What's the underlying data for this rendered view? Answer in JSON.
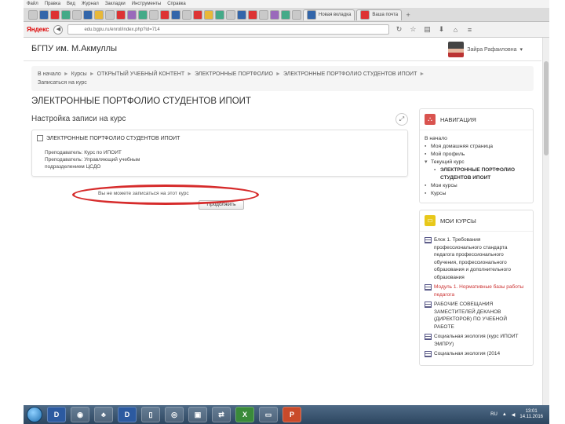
{
  "browser": {
    "menu": [
      "Файл",
      "Правка",
      "Вид",
      "Журнал",
      "Закладки",
      "Инструменты",
      "Справка"
    ],
    "tab_titles": [
      "Новая вкладка",
      "Ваша почта"
    ],
    "search_logo": "Яндекс",
    "url": "edu.bgpu.ru/enrol/index.php?id=714"
  },
  "site": {
    "name": "БГПУ им. М.Акмуллы",
    "user_name": "Зайра Рафаиловна"
  },
  "breadcrumb": {
    "items": [
      "В начало",
      "Курсы",
      "ОТКРЫТЫЙ УЧЕБНЫЙ КОНТЕНТ",
      "ЭЛЕКТРОННЫЕ ПОРТФОЛИО",
      "ЭЛЕКТРОННЫЕ ПОРТФОЛИО СТУДЕНТОВ ИПОИТ",
      "Записаться на курс"
    ]
  },
  "page_title": "ЭЛЕКТРОННЫЕ ПОРТФОЛИО СТУДЕНТОВ ИПОИТ",
  "enrol": {
    "heading": "Настройка записи на курс",
    "course_name": "ЭЛЕКТРОННЫЕ ПОРТФОЛИО СТУДЕНТОВ ИПОИТ",
    "teacher_line": "Преподаватель: Курс по ИПОИТ",
    "teacher_line2": "Преподаватель: Управляющий учебным",
    "teacher_line3": "подразделением ЦСДО",
    "notice": "Вы не можете записаться на этот курс",
    "continue_label": "Продолжить"
  },
  "navigation": {
    "title": "НАВИГАЦИЯ",
    "items": {
      "home": "В начало",
      "dashboard": "Моя домашняя страница",
      "profile": "Мой профиль",
      "current_course": "Текущий курс",
      "course": "ЭЛЕКТРОННЫЕ ПОРТФОЛИО СТУДЕНТОВ ИПОИТ",
      "my_courses": "Мои курсы",
      "courses": "Курсы"
    }
  },
  "my_courses": {
    "title": "МОИ КУРСЫ",
    "items": [
      {
        "label": "Блок 1. Требования профессионального стандарта педагога профессионального обучения, профессионального образования и дополнительного образования",
        "link": false
      },
      {
        "label": "Модуль 1. Нормативные базы работы педагога",
        "link": true
      },
      {
        "label": "РАБОЧИЕ СОВЕЩАНИЯ ЗАМЕСТИТЕЛЕЙ ДЕКАНОВ (ДИРЕКТОРОВ) ПО УЧЕБНОЙ РАБОТЕ",
        "link": false
      },
      {
        "label": "Социальная экология (курс ИПОИТ ЭМПРУ)",
        "link": false
      },
      {
        "label": "Социальная экология (2014",
        "link": false
      }
    ]
  },
  "taskbar": {
    "buttons": [
      "D",
      "D"
    ],
    "lang": "RU",
    "time": "13:01",
    "date": "14.11.2016"
  }
}
